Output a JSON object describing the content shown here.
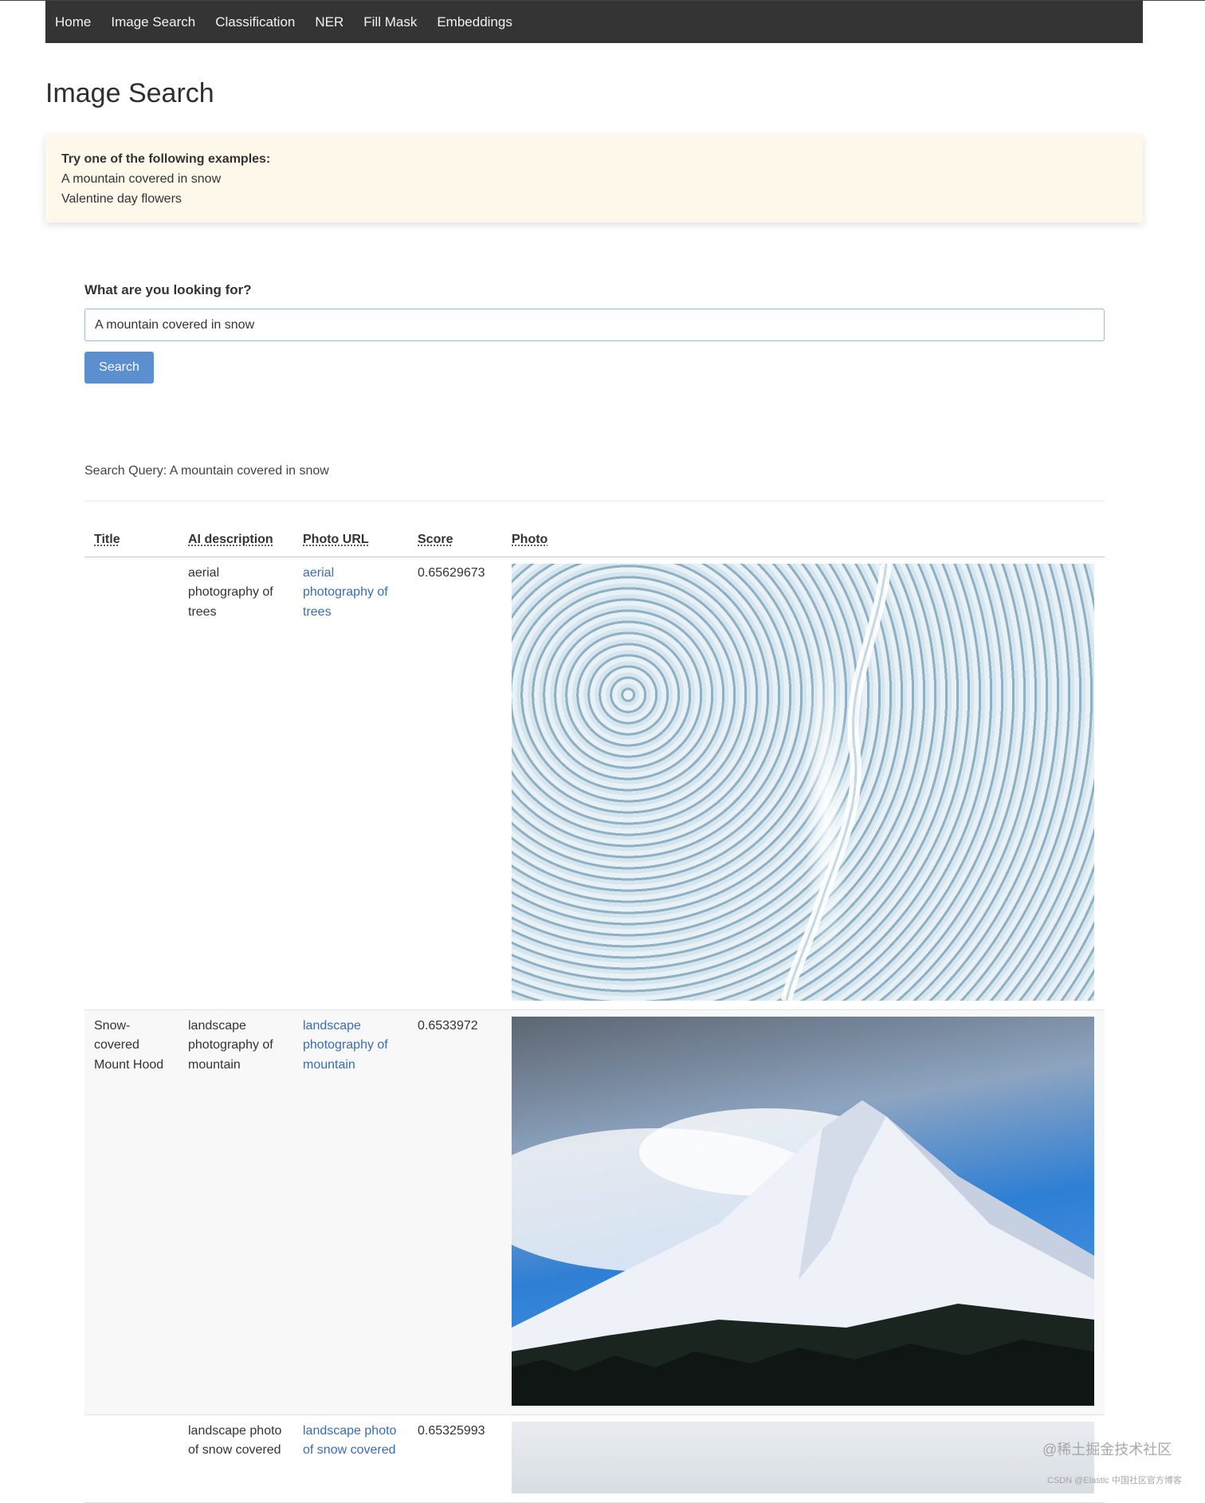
{
  "nav": {
    "items": [
      {
        "label": "Home"
      },
      {
        "label": "Image Search"
      },
      {
        "label": "Classification"
      },
      {
        "label": "NER"
      },
      {
        "label": "Fill Mask"
      },
      {
        "label": "Embeddings"
      }
    ]
  },
  "page": {
    "title": "Image Search"
  },
  "examples": {
    "title": "Try one of the following examples:",
    "items": [
      "A mountain covered in snow",
      "Valentine day flowers"
    ]
  },
  "search": {
    "label": "What are you looking for?",
    "value": "A mountain covered in snow",
    "button_label": "Search"
  },
  "query_line": "Search Query: A mountain covered in snow",
  "table": {
    "headers": [
      "Title",
      "AI description",
      "Photo URL",
      "Score",
      "Photo"
    ],
    "rows": [
      {
        "title": "",
        "ai_description": "aerial photography of trees",
        "photo_url_text": "aerial photography of trees",
        "score": "0.65629673"
      },
      {
        "title": "Snow-covered Mount Hood",
        "ai_description": "landscape photography of mountain",
        "photo_url_text": "landscape photography of mountain",
        "score": "0.6533972"
      },
      {
        "title": "",
        "ai_description": "landscape photo of snow covered",
        "photo_url_text": "landscape photo of snow covered",
        "score": "0.65325993"
      }
    ]
  },
  "watermark": {
    "main": "@稀土掘金技术社区",
    "sub": "CSDN @Elastic 中国社区官方博客"
  },
  "colors": {
    "navbar": "#343434",
    "alert_bg": "#fdf8ea",
    "button": "#5b8fd0",
    "link": "#3a6db4"
  }
}
